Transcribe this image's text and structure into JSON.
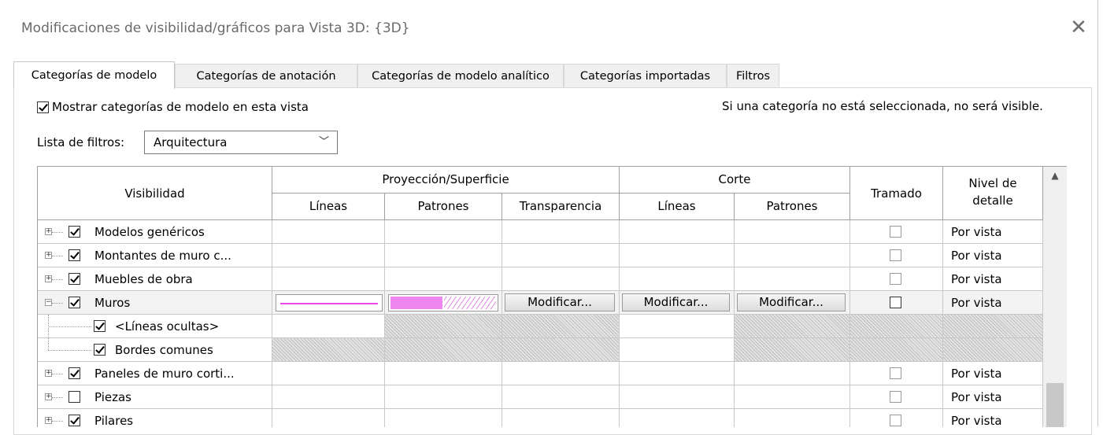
{
  "window": {
    "title": "Modificaciones de visibilidad/gráficos para Vista 3D: {3D}",
    "close_icon": "close-icon"
  },
  "tabs": [
    {
      "label": "Categorías de modelo",
      "active": true
    },
    {
      "label": "Categorías de anotación",
      "active": false
    },
    {
      "label": "Categorías de modelo analítico",
      "active": false
    },
    {
      "label": "Categorías importadas",
      "active": false
    },
    {
      "label": "Filtros",
      "active": false
    }
  ],
  "options": {
    "show_categories_label": "Mostrar categorías de modelo en esta vista",
    "show_categories_checked": true,
    "note": "Si una categoría no está seleccionada, no será visible.",
    "filter_label": "Lista de filtros:",
    "filter_value": "Arquitectura"
  },
  "grid": {
    "headers": {
      "visibility": "Visibilidad",
      "projection": "Proyección/Superficie",
      "cut": "Corte",
      "halftone": "Tramado",
      "detail_level_1": "Nivel de",
      "detail_level_2": "detalle",
      "lines": "Líneas",
      "patterns": "Patrones",
      "transparency": "Transparencia",
      "cut_lines": "Líneas",
      "cut_patterns": "Patrones"
    },
    "rows": [
      {
        "name": "Modelos genéricos",
        "checked": true,
        "expand": "+",
        "level": 0,
        "detail": "Por vista"
      },
      {
        "name": "Montantes de muro c...",
        "checked": true,
        "expand": "+",
        "level": 0,
        "detail": "Por vista"
      },
      {
        "name": "Muebles de obra",
        "checked": true,
        "expand": "+",
        "level": 0,
        "detail": "Por vista"
      },
      {
        "name": "Muros",
        "checked": true,
        "expand": "−",
        "level": 0,
        "detail": "Por vista",
        "selected": true,
        "transparency_btn": "Modificar...",
        "cut_lines_btn": "Modificar...",
        "cut_patterns_btn": "Modificar...",
        "line_color": "#e64be6",
        "pattern_color": "#ef86ef"
      },
      {
        "name": "<Líneas ocultas>",
        "checked": true,
        "level": 1
      },
      {
        "name": "Bordes comunes",
        "checked": true,
        "level": 1
      },
      {
        "name": "Paneles de muro corti...",
        "checked": true,
        "expand": "+",
        "level": 0,
        "detail": "Por vista"
      },
      {
        "name": "Piezas",
        "checked": false,
        "expand": "+",
        "level": 0,
        "detail": "Por vista"
      },
      {
        "name": "Pilares",
        "checked": true,
        "expand": "+",
        "level": 0,
        "detail": "Por vista"
      }
    ]
  }
}
